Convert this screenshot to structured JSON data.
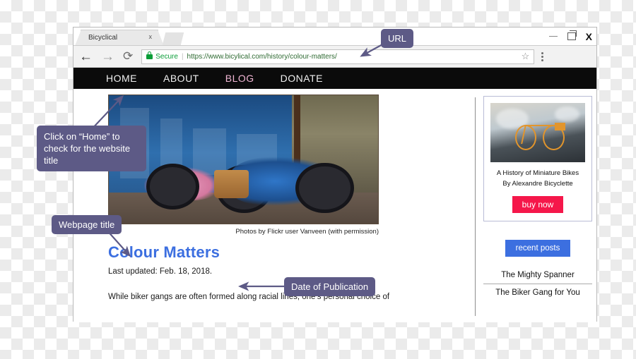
{
  "browser": {
    "tab": {
      "title": "Bicyclical",
      "close_label": "x"
    },
    "window_controls": {
      "minimize": "minimize-icon",
      "maximize": "maximize-icon",
      "close": "X"
    },
    "toolbar": {
      "back": "←",
      "forward": "→",
      "reload": "⟳",
      "security_label": "Secure",
      "separator": "|",
      "url": "https://www.bicylical.com/history/colour-matters/",
      "bookmark": "☆",
      "menu": "kebab-menu-icon"
    }
  },
  "site_nav": {
    "items": [
      {
        "label": "HOME",
        "active": false
      },
      {
        "label": "ABOUT",
        "active": false
      },
      {
        "label": "BLOG",
        "active": true
      },
      {
        "label": "DONATE",
        "active": false
      }
    ],
    "active_color": "#f0b6d4"
  },
  "article": {
    "hero_alt": "pink bicycle and blue vintage motorcycle parked by a blue glass storefront",
    "caption": "Photos by Flickr user Vanveen (with permission)",
    "title": "Colour Matters",
    "title_color": "#3c6fe0",
    "updated": "Last updated: Feb. 18, 2018.",
    "body": "While biker gangs are often formed along racial lines, one’s personal choice of"
  },
  "sidebar": {
    "ad": {
      "image_alt": "orange miniature bicycle on a reflective surface",
      "title_line1": "A History of Miniature Bikes",
      "title_line2": "By Alexandre Bicyclette",
      "cta": "buy now",
      "cta_color": "#f5174a"
    },
    "recent_posts_label": "recent posts",
    "recent_posts_color": "#3c6fe0",
    "posts": [
      {
        "label": "The Mighty Spanner"
      },
      {
        "label": "The Biker Gang for You"
      }
    ]
  },
  "annotations": {
    "color": "#5d5a86",
    "url": "URL",
    "home": "Click on “Home” to check for the website title",
    "webpage_title": "Webpage title",
    "date": "Date of Publication"
  }
}
